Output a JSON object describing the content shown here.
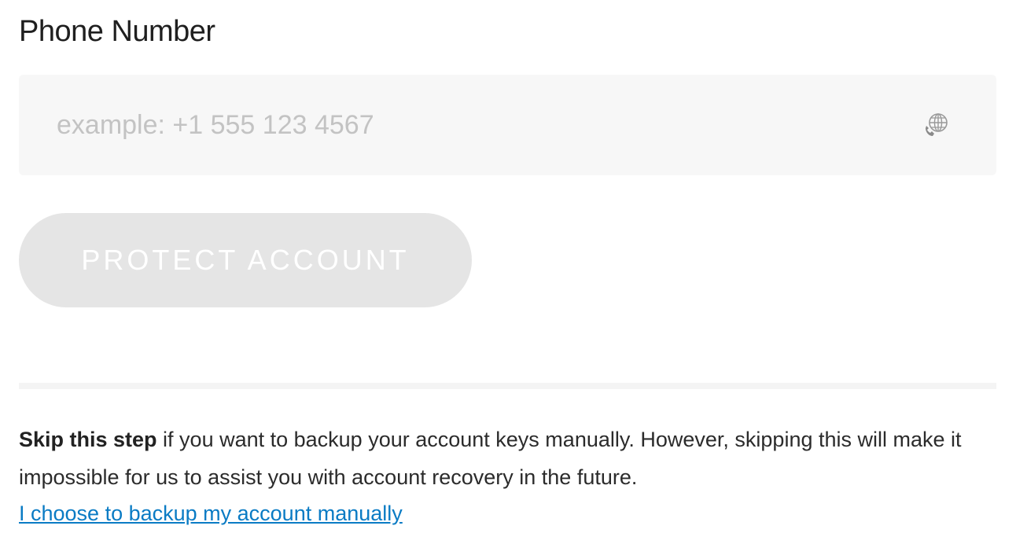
{
  "form": {
    "phone_label": "Phone Number",
    "phone_value": "",
    "phone_placeholder": "example: +1 555 123 4567",
    "country_icon": "globe-phone-icon",
    "protect_button_label": "PROTECT ACCOUNT"
  },
  "skip": {
    "bold_text": "Skip this step",
    "body_text": " if you want to backup your account keys manually. However, skipping this will make it impossible for us to assist you with account recovery in the future.",
    "link_text": "I choose to backup my account manually"
  },
  "colors": {
    "field_background": "#f7f7f7",
    "button_disabled": "#e5e5e5",
    "link": "#0a7bc4"
  }
}
